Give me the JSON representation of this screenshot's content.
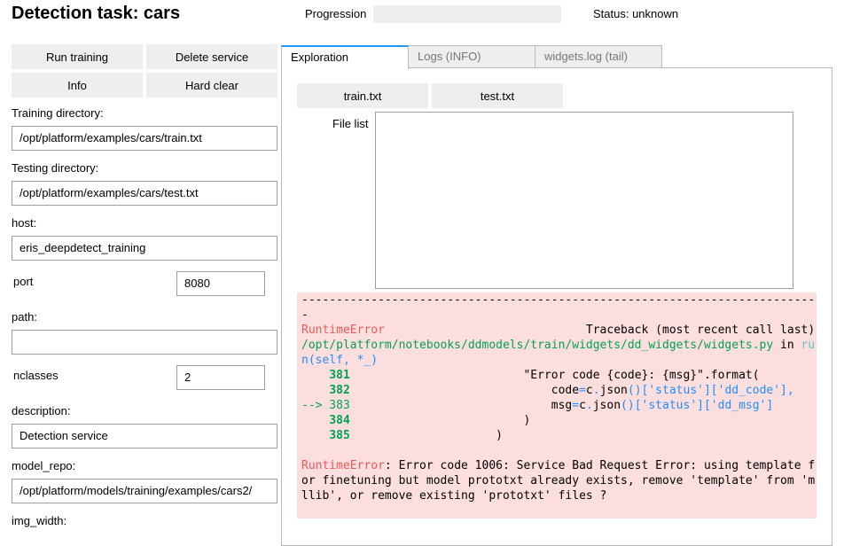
{
  "title": "Detection task: cars",
  "progress": {
    "label": "Progression",
    "value": 0
  },
  "status": "Status: unknown",
  "buttons": {
    "run": "Run training",
    "delete": "Delete service",
    "info": "Info",
    "hard_clear": "Hard clear"
  },
  "fields": {
    "training_dir": {
      "label": "Training directory:",
      "value": "/opt/platform/examples/cars/train.txt"
    },
    "testing_dir": {
      "label": "Testing directory:",
      "value": "/opt/platform/examples/cars/test.txt"
    },
    "host": {
      "label": "host:",
      "value": "eris_deepdetect_training"
    },
    "port": {
      "label": "port",
      "value": "8080"
    },
    "path": {
      "label": "path:",
      "value": ""
    },
    "nclasses": {
      "label": "nclasses",
      "value": "2"
    },
    "description": {
      "label": "description:",
      "value": "Detection service"
    },
    "model_repo": {
      "label": "model_repo:",
      "value": "/opt/platform/models/training/examples/cars2/"
    },
    "img_width": {
      "label": "img_width:"
    }
  },
  "tabs": [
    "Exploration",
    "Logs (INFO)",
    "widgets.log (tail)"
  ],
  "exploration": {
    "train_btn": "train.txt",
    "test_btn": "test.txt",
    "file_list_label": "File list"
  },
  "traceback": [
    [
      [
        "",
        "---------------------------------------------------------------------------"
      ]
    ],
    [
      [
        "red",
        "RuntimeError"
      ],
      [
        "",
        "                             Traceback (most recent call last)"
      ]
    ],
    [
      [
        "green",
        "/opt/platform/notebooks/ddmodels/train/widgets/dd_widgets/widgets.py"
      ],
      [
        "",
        " in "
      ],
      [
        "cyan",
        "ru"
      ],
      [
        "blue",
        "n(self, *_)"
      ]
    ],
    [
      [
        "",
        "    "
      ],
      [
        "bgreen",
        "381"
      ],
      [
        "",
        "                         \"Error code {code}: {msg}\".format("
      ]
    ],
    [
      [
        "",
        "    "
      ],
      [
        "bgreen",
        "382"
      ],
      [
        "",
        "                             code"
      ],
      [
        "blue",
        "="
      ],
      [
        "",
        "c"
      ],
      [
        "blue",
        "."
      ],
      [
        "",
        "json"
      ],
      [
        "blue",
        "()['status']['dd_code'],"
      ]
    ],
    [
      [
        "green",
        "--> 383"
      ],
      [
        "",
        "                             msg"
      ],
      [
        "blue",
        "="
      ],
      [
        "",
        "c"
      ],
      [
        "blue",
        "."
      ],
      [
        "",
        "json"
      ],
      [
        "blue",
        "()['status']['dd_msg']"
      ]
    ],
    [
      [
        "",
        "    "
      ],
      [
        "bgreen",
        "384"
      ],
      [
        "",
        "                         )"
      ]
    ],
    [
      [
        "",
        "    "
      ],
      [
        "bgreen",
        "385"
      ],
      [
        "",
        "                     )"
      ]
    ],
    [
      [
        "",
        ""
      ]
    ],
    [
      [
        "red",
        "RuntimeError"
      ],
      [
        "",
        ": Error code 1006: Service Bad Request Error: using template for finetuning but model prototxt already exists, remove 'template' from 'mllib', or remove existing 'prototxt' files ?"
      ]
    ]
  ]
}
